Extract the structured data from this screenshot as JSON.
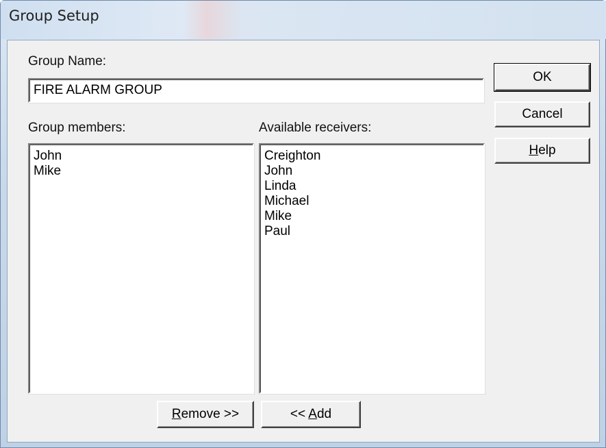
{
  "window": {
    "title": "Group Setup"
  },
  "group_name": {
    "label": "Group Name:",
    "value": "FIRE ALARM GROUP"
  },
  "members": {
    "label": "Group members:",
    "items": [
      "John",
      "Mike"
    ]
  },
  "receivers": {
    "label": "Available receivers:",
    "items": [
      "Creighton",
      "John",
      "Linda",
      "Michael",
      "Mike",
      "Paul"
    ]
  },
  "buttons": {
    "ok": "OK",
    "cancel": "Cancel",
    "help": {
      "mnemonic": "H",
      "rest": "elp"
    },
    "remove": {
      "mnemonic": "R",
      "rest": "emove >>"
    },
    "add": {
      "prefix": "<< ",
      "mnemonic": "A",
      "rest": "dd"
    }
  }
}
